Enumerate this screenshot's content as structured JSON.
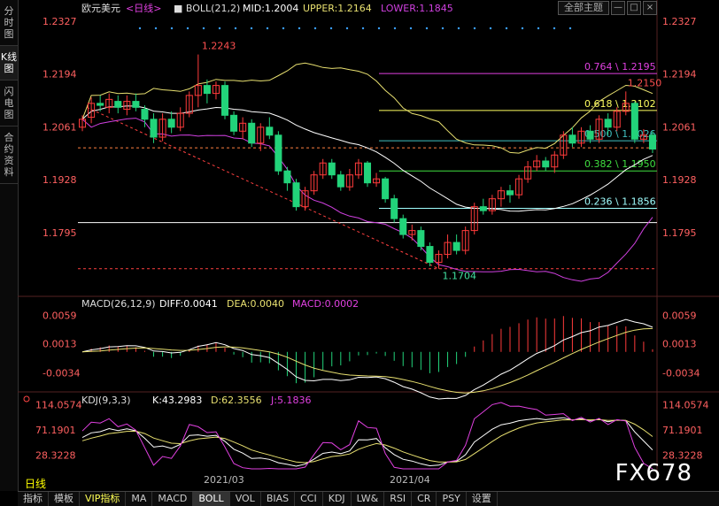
{
  "sidebar": {
    "tabs": [
      "分时图",
      "K线图",
      "闪电图",
      "合约资料"
    ],
    "active": 1
  },
  "header": {
    "symbol": "欧元美元",
    "period_tag": "<日线>",
    "boll_label": "BOLL(21,2)",
    "mid": "MID:1.2004",
    "upper": "UPPER:1.2164",
    "lower": "LOWER:1.1845",
    "main_select": "全部主题",
    "win_buttons": [
      "minimize-icon",
      "restore-icon",
      "close-icon"
    ]
  },
  "macd_header": {
    "label": "MACD(26,12,9)",
    "diff": "DIFF:0.0041",
    "dea": "DEA:0.0040",
    "macd": "MACD:0.0002"
  },
  "kdj_header": {
    "label": "KDJ(9,3,3)",
    "k": "K:43.2983",
    "d": "D:62.3556",
    "j": "J:5.1836"
  },
  "period_label": "日线",
  "watermark": "FX678",
  "toolbar": [
    "指标",
    "模板",
    "VIP指标",
    "MA",
    "MACD",
    "BOLL",
    "VOL",
    "BIAS",
    "CCI",
    "KDJ",
    "LW&",
    "RSI",
    "CR",
    "PSY",
    "设置"
  ],
  "toolbar_active": "BOLL",
  "colors": {
    "up": "#ff3b3b",
    "down": "#22d37a",
    "upper": "#e8e070",
    "mid": "#ffffff",
    "lower": "#d040e0",
    "diff": "#ffffff",
    "dea": "#e8e070"
  },
  "chart_data": [
    {
      "type": "candlestick",
      "name": "price",
      "ylim": [
        1.1704,
        1.2327
      ],
      "y_ticks": [
        "1.2327",
        "1.2194",
        "1.2061",
        "1.1928",
        "1.1795"
      ],
      "x_labels": [
        "2021/03",
        "2021/04"
      ],
      "annotations": [
        "1.2243",
        "1.2150",
        "1.1704"
      ],
      "fib_levels": [
        {
          "label": "0.764 \\ 1.2195",
          "value": 1.2195,
          "color": "#e040e0"
        },
        {
          "label": "0.618 \\ 1.2102",
          "value": 1.2102,
          "color": "#ffff60"
        },
        {
          "label": "0.500 \\ 1.2026",
          "value": 1.2026,
          "color": "#40c0c0"
        },
        {
          "label": "0.382 \\ 1.1950",
          "value": 1.195,
          "color": "#40e040"
        },
        {
          "label": "0.236 \\ 1.1856",
          "value": 1.1856,
          "color": "#a0ffff"
        }
      ],
      "last_price_line": 1.2008,
      "candles": [
        [
          1.206,
          1.208,
          1.205,
          1.209
        ],
        [
          1.2085,
          1.212,
          1.207,
          1.2135
        ],
        [
          1.212,
          1.2115,
          1.21,
          1.214
        ],
        [
          1.211,
          1.213,
          1.2095,
          1.2145
        ],
        [
          1.2125,
          1.211,
          1.2095,
          1.214
        ],
        [
          1.2105,
          1.2125,
          1.209,
          1.214
        ],
        [
          1.2125,
          1.211,
          1.21,
          1.2145
        ],
        [
          1.2105,
          1.208,
          1.206,
          1.2115
        ],
        [
          1.208,
          1.2035,
          1.202,
          1.2095
        ],
        [
          1.2035,
          1.208,
          1.2025,
          1.2095
        ],
        [
          1.208,
          1.206,
          1.2045,
          1.21
        ],
        [
          1.206,
          1.2095,
          1.205,
          1.211
        ],
        [
          1.2095,
          1.214,
          1.2085,
          1.215
        ],
        [
          1.214,
          1.2165,
          1.211,
          1.2243
        ],
        [
          1.2165,
          1.2145,
          1.212,
          1.218
        ],
        [
          1.2145,
          1.2165,
          1.213,
          1.2175
        ],
        [
          1.2165,
          1.209,
          1.208,
          1.2175
        ],
        [
          1.209,
          1.205,
          1.204,
          1.21
        ],
        [
          1.205,
          1.207,
          1.203,
          1.2085
        ],
        [
          1.207,
          1.202,
          1.201,
          1.208
        ],
        [
          1.202,
          1.206,
          1.2,
          1.207
        ],
        [
          1.206,
          1.204,
          1.203,
          1.2085
        ],
        [
          1.204,
          1.195,
          1.194,
          1.205
        ],
        [
          1.195,
          1.192,
          1.19,
          1.196
        ],
        [
          1.192,
          1.186,
          1.185,
          1.193
        ],
        [
          1.186,
          1.19,
          1.185,
          1.191
        ],
        [
          1.19,
          1.194,
          1.189,
          1.195
        ],
        [
          1.194,
          1.197,
          1.193,
          1.198
        ],
        [
          1.197,
          1.194,
          1.193,
          1.198
        ],
        [
          1.194,
          1.191,
          1.19,
          1.195
        ],
        [
          1.191,
          1.194,
          1.19,
          1.1955
        ],
        [
          1.194,
          1.197,
          1.193,
          1.198
        ],
        [
          1.197,
          1.192,
          1.191,
          1.1975
        ],
        [
          1.192,
          1.193,
          1.191,
          1.1945
        ],
        [
          1.193,
          1.188,
          1.187,
          1.1935
        ],
        [
          1.188,
          1.183,
          1.182,
          1.189
        ],
        [
          1.183,
          1.179,
          1.178,
          1.184
        ],
        [
          1.179,
          1.18,
          1.1775,
          1.1815
        ],
        [
          1.18,
          1.176,
          1.175,
          1.181
        ],
        [
          1.176,
          1.172,
          1.171,
          1.177
        ],
        [
          1.172,
          1.174,
          1.1704,
          1.175
        ],
        [
          1.174,
          1.177,
          1.173,
          1.179
        ],
        [
          1.177,
          1.175,
          1.174,
          1.179
        ],
        [
          1.175,
          1.18,
          1.174,
          1.181
        ],
        [
          1.18,
          1.186,
          1.179,
          1.187
        ],
        [
          1.186,
          1.185,
          1.184,
          1.188
        ],
        [
          1.185,
          1.188,
          1.184,
          1.189
        ],
        [
          1.188,
          1.19,
          1.186,
          1.191
        ],
        [
          1.19,
          1.189,
          1.187,
          1.1915
        ],
        [
          1.189,
          1.193,
          1.188,
          1.194
        ],
        [
          1.193,
          1.196,
          1.192,
          1.1975
        ],
        [
          1.196,
          1.1975,
          1.195,
          1.199
        ],
        [
          1.1975,
          1.196,
          1.195,
          1.1985
        ],
        [
          1.196,
          1.199,
          1.1945,
          1.2
        ],
        [
          1.199,
          1.204,
          1.198,
          1.205
        ],
        [
          1.204,
          1.202,
          1.201,
          1.206
        ],
        [
          1.202,
          1.205,
          1.201,
          1.206
        ],
        [
          1.205,
          1.203,
          1.202,
          1.2065
        ],
        [
          1.203,
          1.208,
          1.202,
          1.209
        ],
        [
          1.208,
          1.206,
          1.204,
          1.2095
        ],
        [
          1.206,
          1.21,
          1.205,
          1.211
        ],
        [
          1.21,
          1.212,
          1.209,
          1.215
        ],
        [
          1.212,
          1.203,
          1.202,
          1.2125
        ],
        [
          1.203,
          1.204,
          1.202,
          1.2055
        ],
        [
          1.204,
          1.2005,
          1.1995,
          1.205
        ]
      ]
    },
    {
      "type": "bar+line",
      "name": "MACD",
      "y_ticks": [
        "0.0059",
        "0.0013",
        "-0.0034"
      ],
      "ylim": [
        -0.006,
        0.0075
      ]
    },
    {
      "type": "line",
      "name": "KDJ",
      "y_ticks": [
        "114.0574",
        "71.1901",
        "28.3228"
      ],
      "ylim": [
        5,
        118
      ]
    }
  ]
}
